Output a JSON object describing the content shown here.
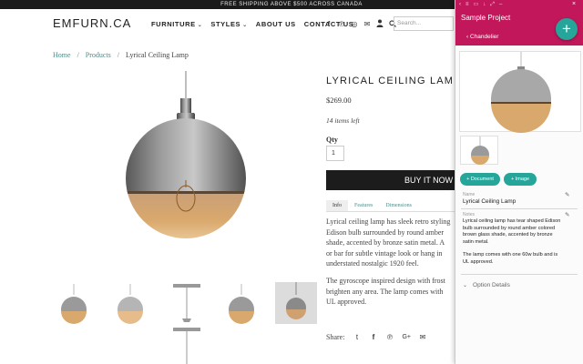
{
  "banner": "FREE SHIPPING ABOVE $500 ACROSS CANADA",
  "logo": "EMFURN.CA",
  "nav": {
    "furniture": "FURNITURE",
    "styles": "STYLES",
    "about": "ABOUT US",
    "contact": "CONTACT US",
    "search_placeholder": "Search..."
  },
  "breadcrumb": {
    "home": "Home",
    "products": "Products",
    "current": "Lyrical Ceiling Lamp",
    "sep": "/"
  },
  "product": {
    "title": "LYRICAL CEILING LAMP",
    "price": "$269.00",
    "stock": "14 items left",
    "qty_label": "Qty",
    "qty_value": "1",
    "buy_label": "BUY IT NOW",
    "tabs": [
      "Info",
      "Features",
      "Dimensions"
    ],
    "desc1": [
      "Lyrical ceiling lamp has sleek retro styling",
      "Edison bulb surrounded by round amber",
      "shade, accented by bronze satin metal. A",
      "or bar for subtle vintage look or hang in",
      "understated nostalgic 1920 feel."
    ],
    "desc2": [
      "The gyroscope inspired design with frost",
      "brighten any area. The lamp comes with",
      "UL approved."
    ],
    "share_label": "Share:"
  },
  "panel": {
    "title": "Sample Project",
    "back_label": "Chandelier",
    "add_label": "+",
    "document_btn": "+ Document",
    "image_btn": "+ Image",
    "name_label": "Name",
    "name_value": "Lyrical Ceiling Lamp",
    "notes_label": "Notes",
    "notes_p1": [
      "Lyrical ceiling lamp has tear shaped Edison",
      "bulb surrounded by round amber colored",
      "brown glass shade, accented by bronze",
      "satin metal."
    ],
    "notes_p2": [
      "The lamp comes with one 60w bulb and is",
      "UL approved."
    ],
    "option_details": "Option Details"
  },
  "colors": {
    "accent_teal": "#26a69a",
    "panel_header": "#c2185b",
    "link": "#4a8f8a",
    "buy_button": "#1c1c1c"
  }
}
